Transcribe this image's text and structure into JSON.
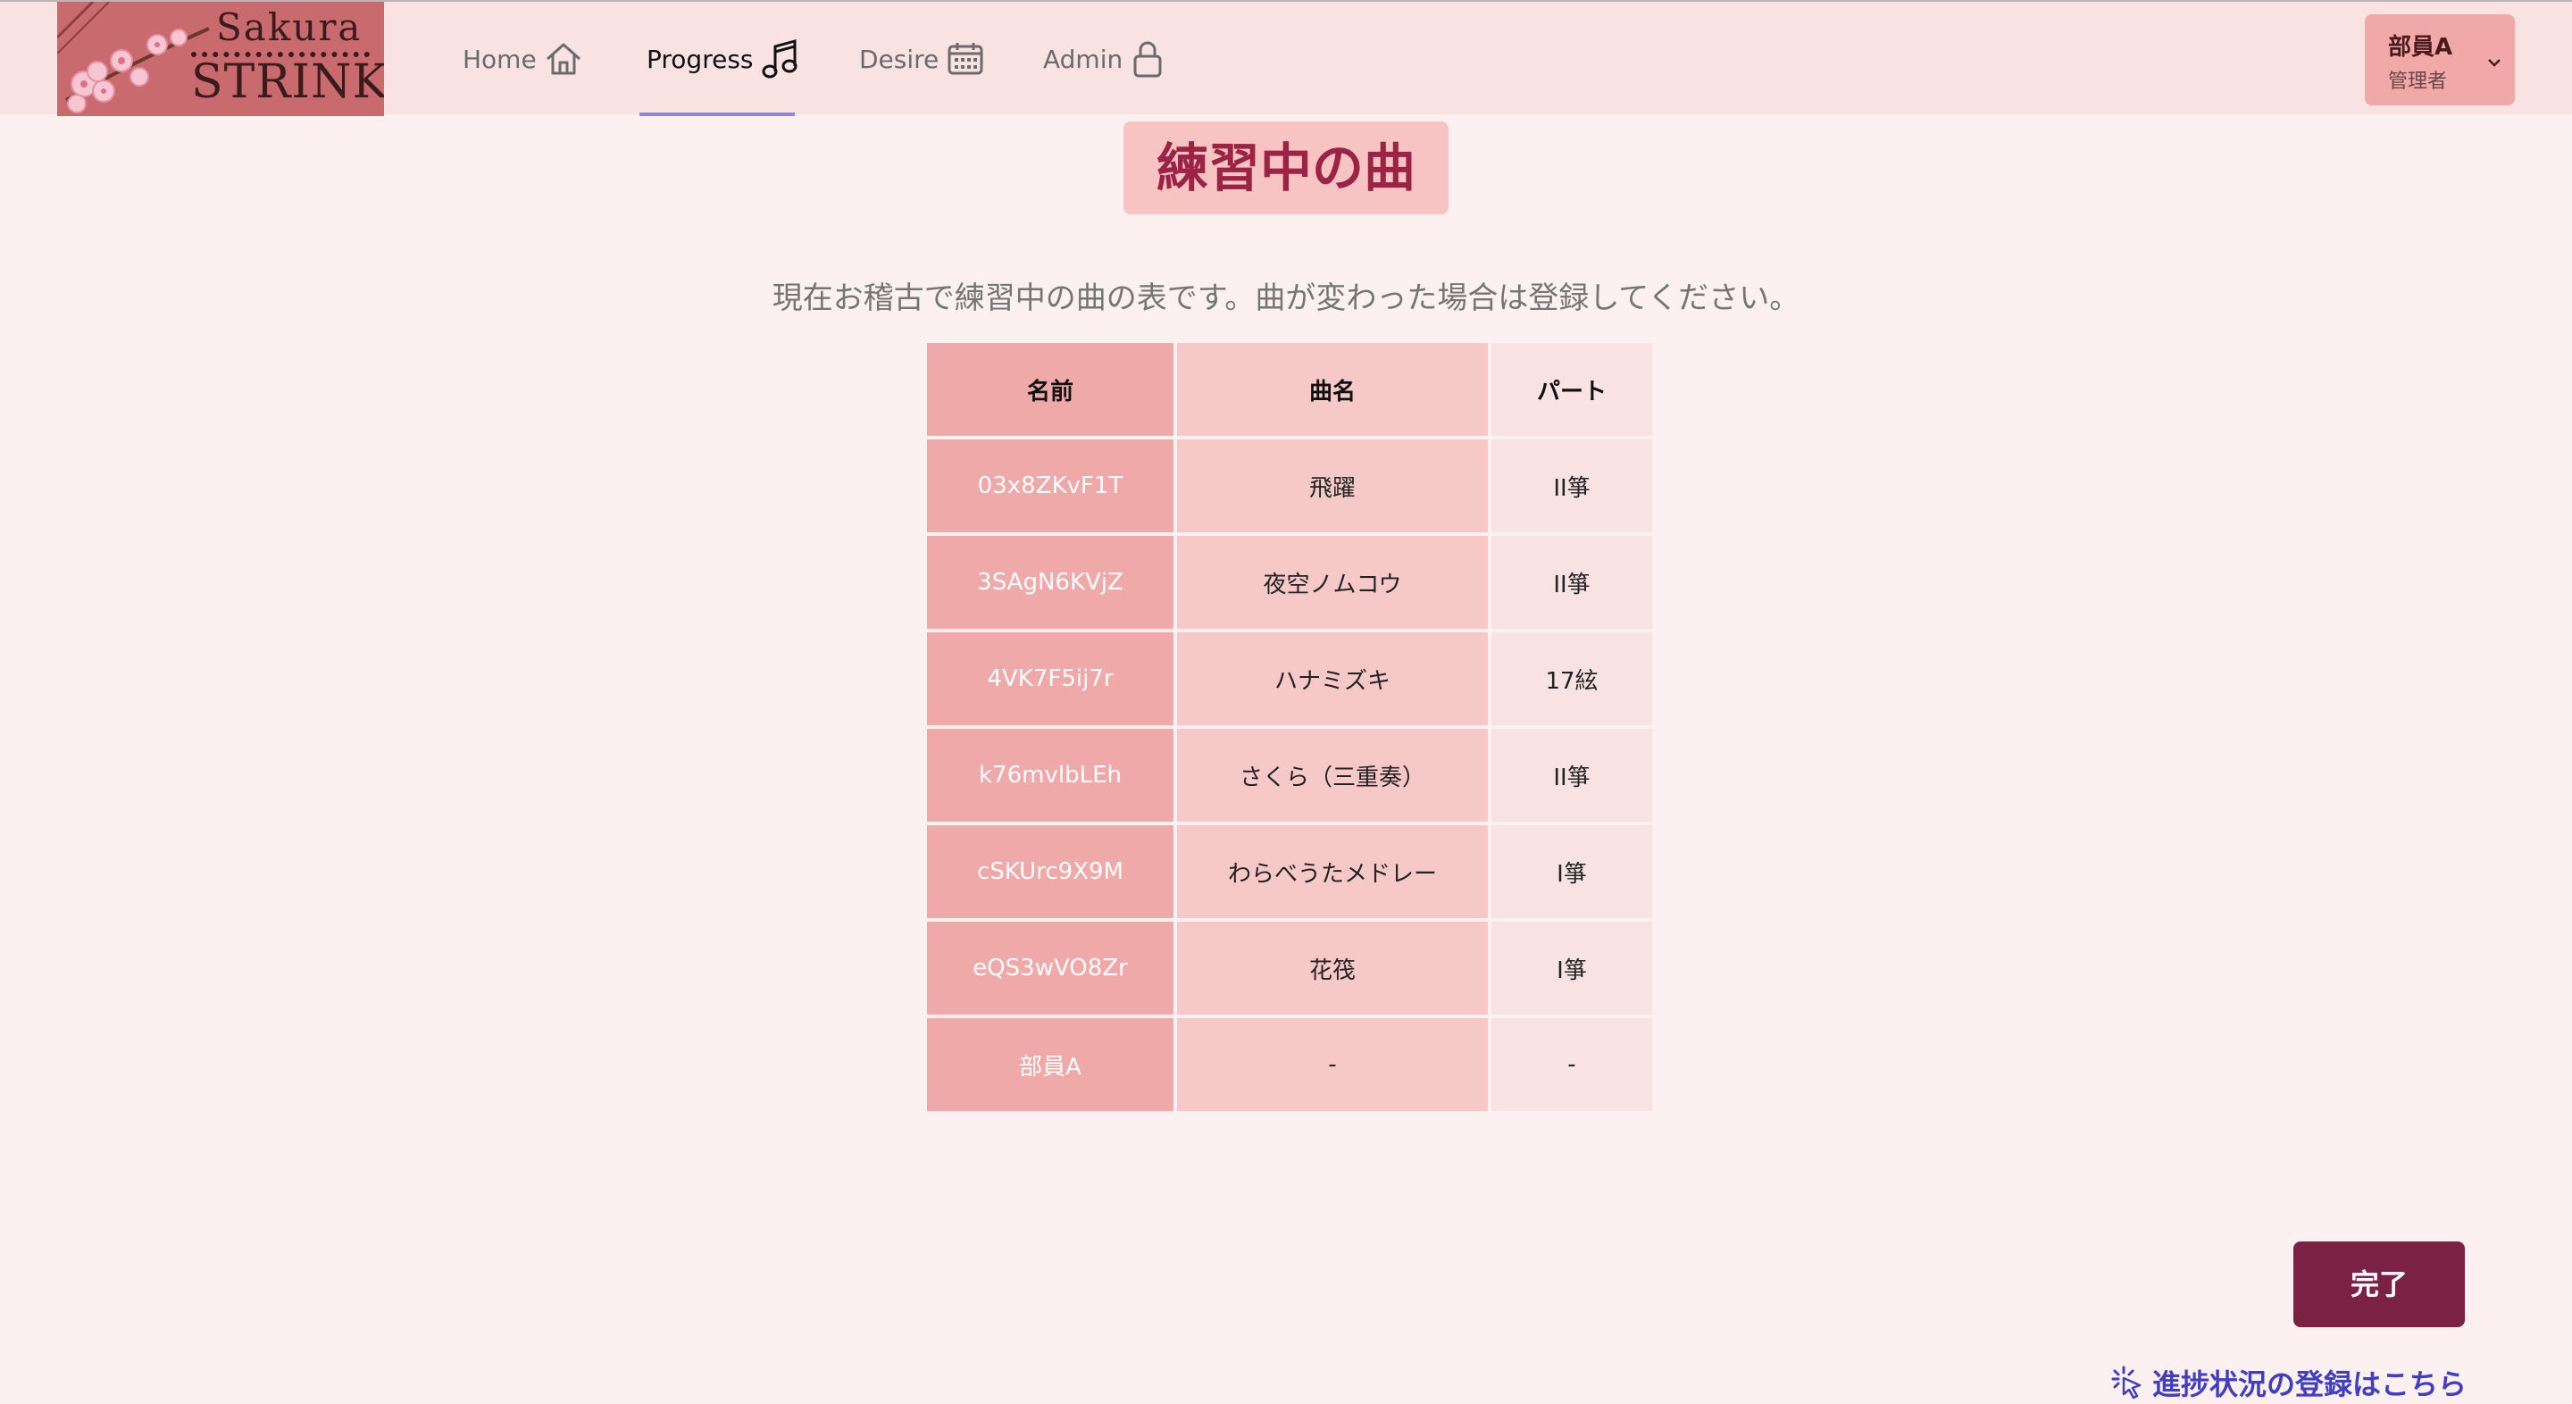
{
  "logo": {
    "line1": "Sakura",
    "line2": "STRINKS"
  },
  "nav": [
    {
      "label": "Home",
      "icon": "home-icon"
    },
    {
      "label": "Progress",
      "icon": "music-note-icon"
    },
    {
      "label": "Desire",
      "icon": "calendar-icon"
    },
    {
      "label": "Admin",
      "icon": "lock-icon"
    }
  ],
  "user": {
    "name": "部員A",
    "role": "管理者"
  },
  "page": {
    "title": "練習中の曲",
    "description": "現在お稽古で練習中の曲の表です。曲が変わった場合は登録してください。"
  },
  "table": {
    "headers": [
      "名前",
      "曲名",
      "パート"
    ],
    "rows": [
      [
        "03x8ZKvF1T",
        "飛躍",
        "II箏"
      ],
      [
        "3SAgN6KVjZ",
        "夜空ノムコウ",
        "II箏"
      ],
      [
        "4VK7F5ij7r",
        "ハナミズキ",
        "17絃"
      ],
      [
        "k76mvlbLEh",
        "さくら（三重奏）",
        "II箏"
      ],
      [
        "cSKUrc9X9M",
        "わらべうたメドレー",
        "I箏"
      ],
      [
        "eQS3wVO8Zr",
        "花筏",
        "I箏"
      ],
      [
        "部員A",
        "-",
        "-"
      ]
    ]
  },
  "actions": {
    "done_label": "完了",
    "register_link": "進捗状況の登録はこちら"
  },
  "colors": {
    "header_bg": "#f9e2e2",
    "accent": "#7b2144",
    "title_text": "#9c2346",
    "nav_underline": "#8a86e8",
    "link": "#3f3fc0"
  }
}
